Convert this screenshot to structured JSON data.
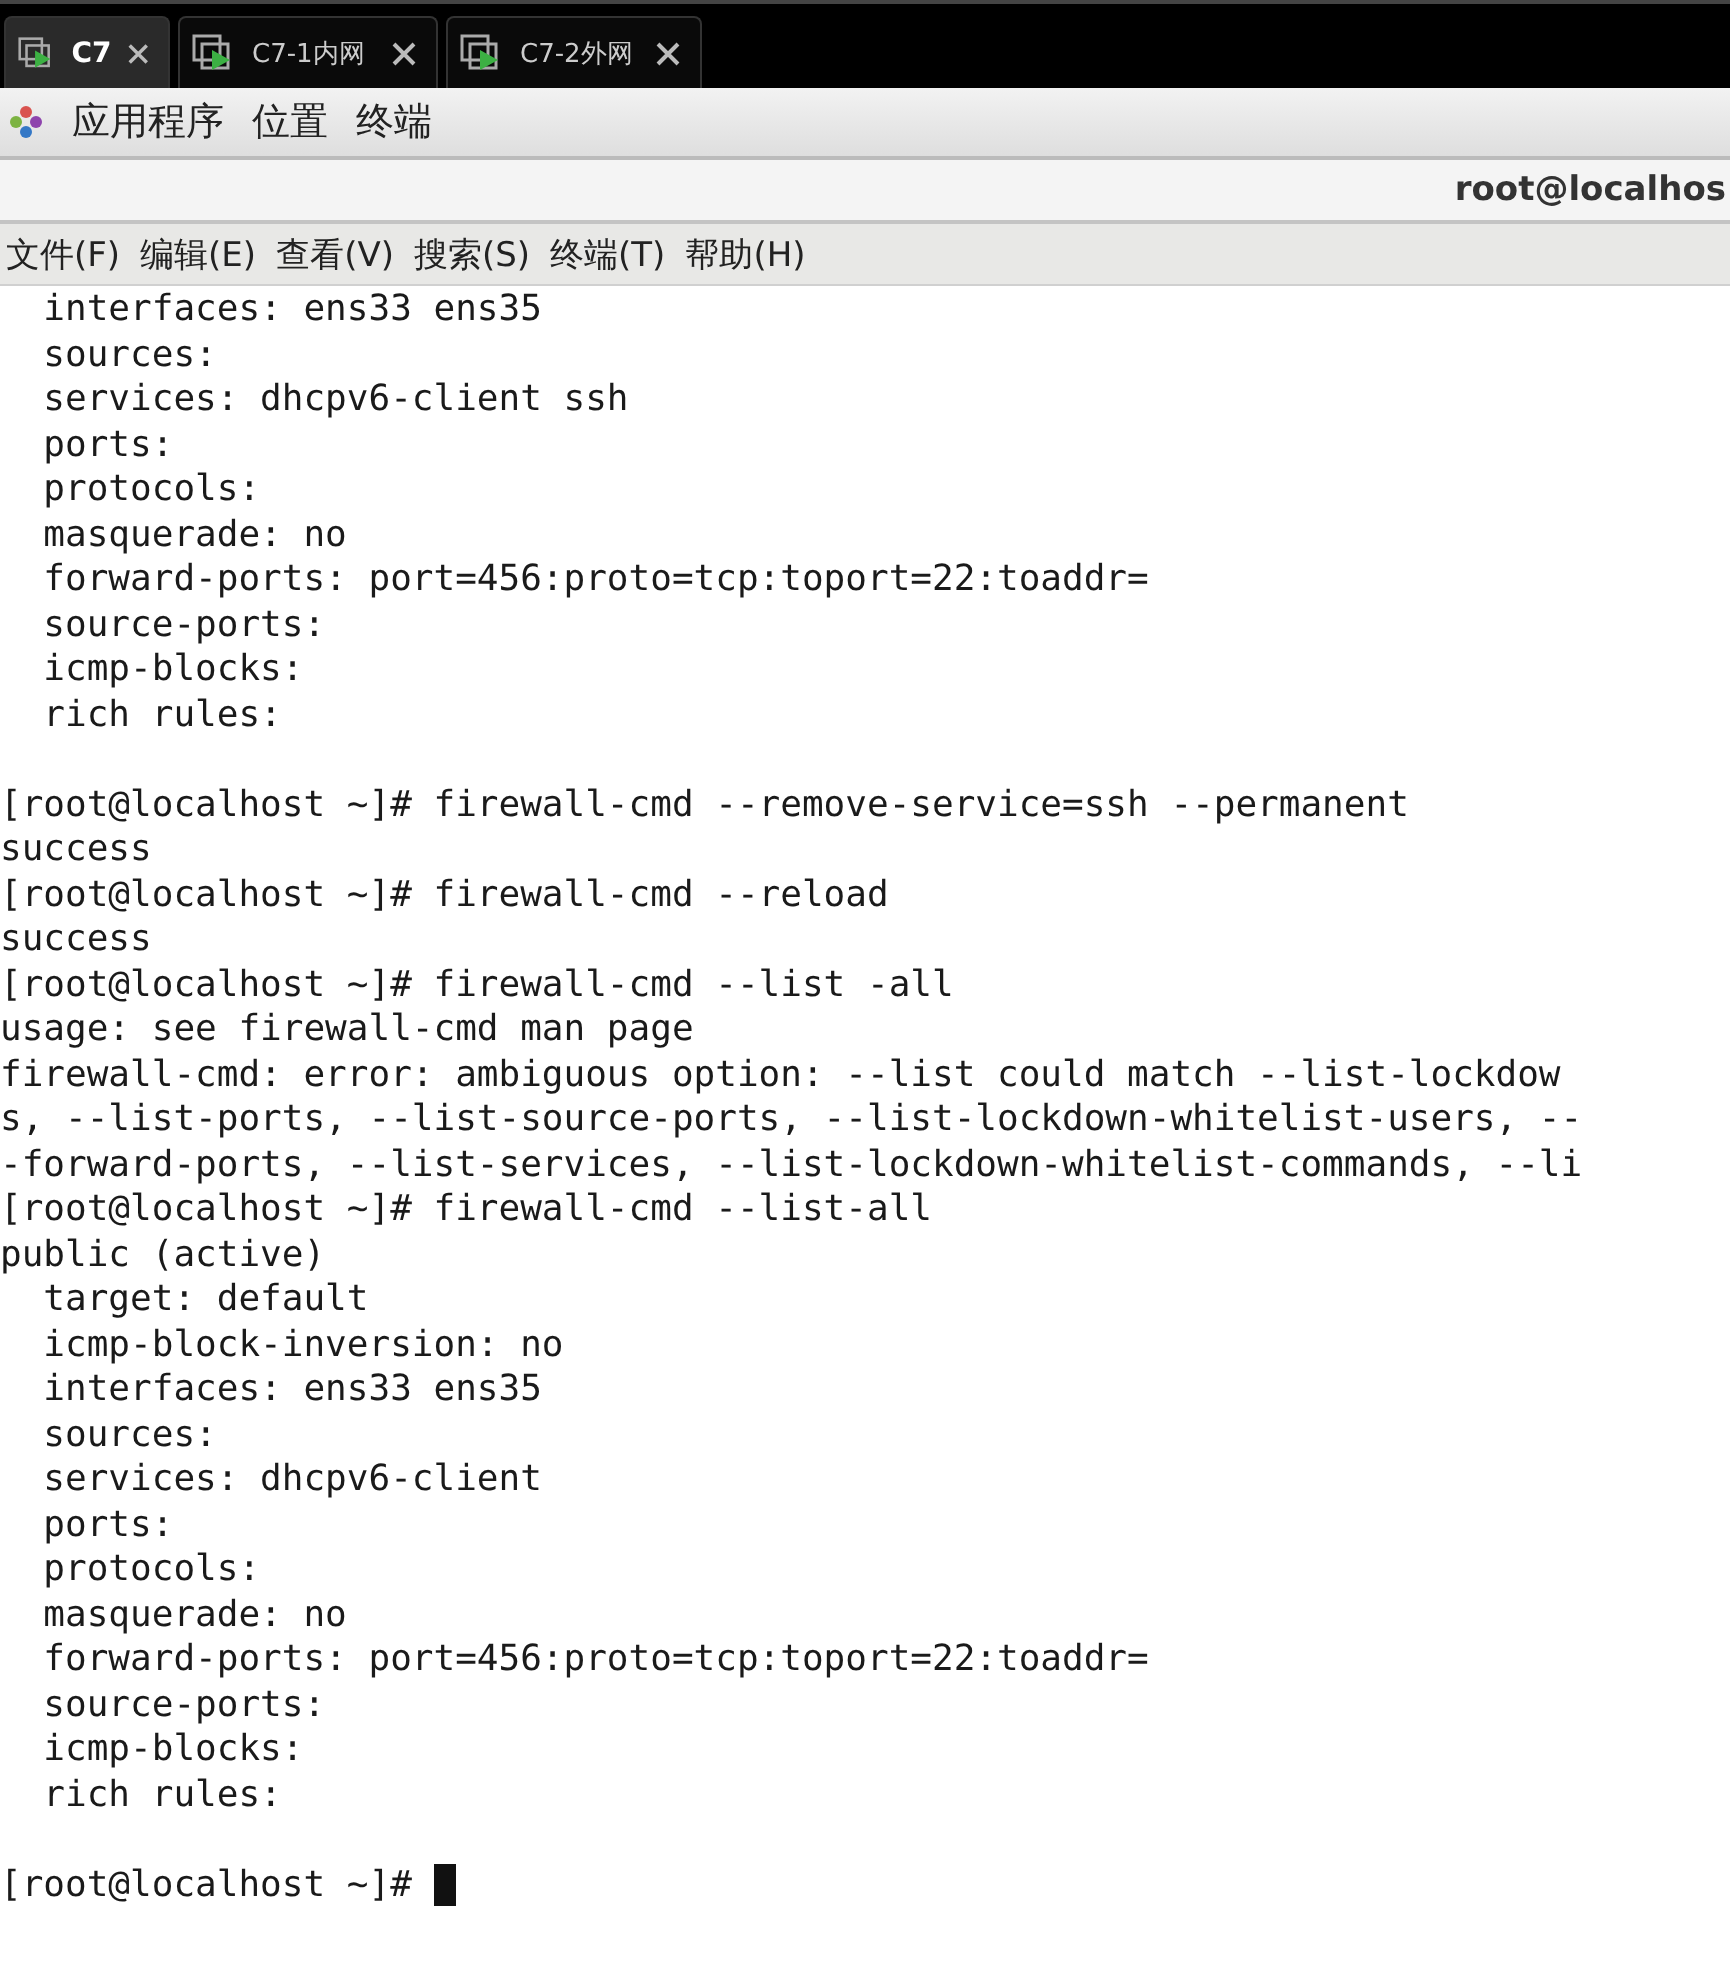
{
  "tabs": [
    {
      "label": "C7",
      "selected": true
    },
    {
      "label": "C7-1内网",
      "selected": false
    },
    {
      "label": "C7-2外网",
      "selected": false
    }
  ],
  "top_bar": {
    "menus": [
      "应用程序",
      "位置",
      "终端"
    ]
  },
  "window": {
    "title": "root@localhos"
  },
  "menu_bar": [
    "文件(F)",
    "编辑(E)",
    "查看(V)",
    "搜索(S)",
    "终端(T)",
    "帮助(H)"
  ],
  "terminal": {
    "lines": [
      {
        "kind": "text",
        "text": "  interfaces: ens33 ens35"
      },
      {
        "kind": "text",
        "text": "  sources:"
      },
      {
        "kind": "text",
        "text": "  services: dhcpv6-client ssh"
      },
      {
        "kind": "text",
        "text": "  ports:"
      },
      {
        "kind": "text",
        "text": "  protocols:"
      },
      {
        "kind": "text",
        "text": "  masquerade: no"
      },
      {
        "kind": "text",
        "text": "  forward-ports: port=456:proto=tcp:toport=22:toaddr="
      },
      {
        "kind": "text",
        "text": "  source-ports:"
      },
      {
        "kind": "text",
        "text": "  icmp-blocks:"
      },
      {
        "kind": "text",
        "text": "  rich rules:"
      },
      {
        "kind": "blank"
      },
      {
        "kind": "text",
        "text": "[root@localhost ~]# firewall-cmd --remove-service=ssh --permanent"
      },
      {
        "kind": "text",
        "text": "success"
      },
      {
        "kind": "text",
        "text": "[root@localhost ~]# firewall-cmd --reload"
      },
      {
        "kind": "text",
        "text": "success"
      },
      {
        "kind": "text",
        "text": "[root@localhost ~]# firewall-cmd --list -all"
      },
      {
        "kind": "text",
        "text": "usage: see firewall-cmd man page"
      },
      {
        "kind": "text",
        "text": "firewall-cmd: error: ambiguous option: --list could match --list-lockdow"
      },
      {
        "kind": "text",
        "text": "s, --list-ports, --list-source-ports, --list-lockdown-whitelist-users, --"
      },
      {
        "kind": "text",
        "text": "-forward-ports, --list-services, --list-lockdown-whitelist-commands, --li"
      },
      {
        "kind": "text",
        "text": "[root@localhost ~]# firewall-cmd --list-all"
      },
      {
        "kind": "text",
        "text": "public (active)"
      },
      {
        "kind": "text",
        "text": "  target: default"
      },
      {
        "kind": "text",
        "text": "  icmp-block-inversion: no"
      },
      {
        "kind": "text",
        "text": "  interfaces: ens33 ens35"
      },
      {
        "kind": "text",
        "text": "  sources:"
      },
      {
        "kind": "text",
        "text": "  services: dhcpv6-client"
      },
      {
        "kind": "text",
        "text": "  ports:"
      },
      {
        "kind": "text",
        "text": "  protocols:"
      },
      {
        "kind": "text",
        "text": "  masquerade: no"
      },
      {
        "kind": "text",
        "text": "  forward-ports: port=456:proto=tcp:toport=22:toaddr="
      },
      {
        "kind": "text",
        "text": "  source-ports:"
      },
      {
        "kind": "text",
        "text": "  icmp-blocks:"
      },
      {
        "kind": "text",
        "text": "  rich rules:"
      },
      {
        "kind": "blank"
      },
      {
        "kind": "text",
        "text": "[root@localhost ~]# "
      }
    ],
    "cursor": true
  }
}
